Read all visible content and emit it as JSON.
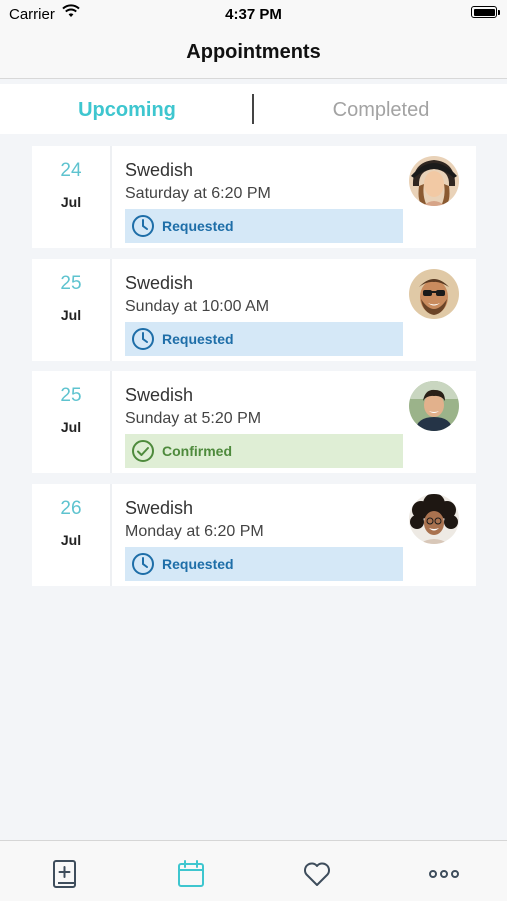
{
  "status": {
    "carrier": "Carrier",
    "time": "4:37 PM"
  },
  "nav": {
    "title": "Appointments"
  },
  "segments": {
    "upcoming": "Upcoming",
    "completed": "Completed",
    "active": "upcoming"
  },
  "appointments": [
    {
      "day": "24",
      "month": "Jul",
      "service": "Swedish",
      "when": "Saturday at 6:20 PM",
      "status": "Requested",
      "status_kind": "requested"
    },
    {
      "day": "25",
      "month": "Jul",
      "service": "Swedish",
      "when": "Sunday at 10:00 AM",
      "status": "Requested",
      "status_kind": "requested"
    },
    {
      "day": "25",
      "month": "Jul",
      "service": "Swedish",
      "when": "Sunday at 5:20 PM",
      "status": "Confirmed",
      "status_kind": "confirmed"
    },
    {
      "day": "26",
      "month": "Jul",
      "service": "Swedish",
      "when": "Monday at 6:20 PM",
      "status": "Requested",
      "status_kind": "requested"
    }
  ],
  "tabs": [
    {
      "icon": "add-booking-icon",
      "active": false
    },
    {
      "icon": "calendar-icon",
      "active": true
    },
    {
      "icon": "heart-icon",
      "active": false
    },
    {
      "icon": "more-icon",
      "active": false
    }
  ],
  "colors": {
    "accent": "#3ec6cf",
    "requested_bg": "#d5e8f7",
    "requested_fg": "#1e6ea8",
    "confirmed_bg": "#dfeed5",
    "confirmed_fg": "#4e8a3c",
    "tab_icon": "#3e4d5c"
  }
}
